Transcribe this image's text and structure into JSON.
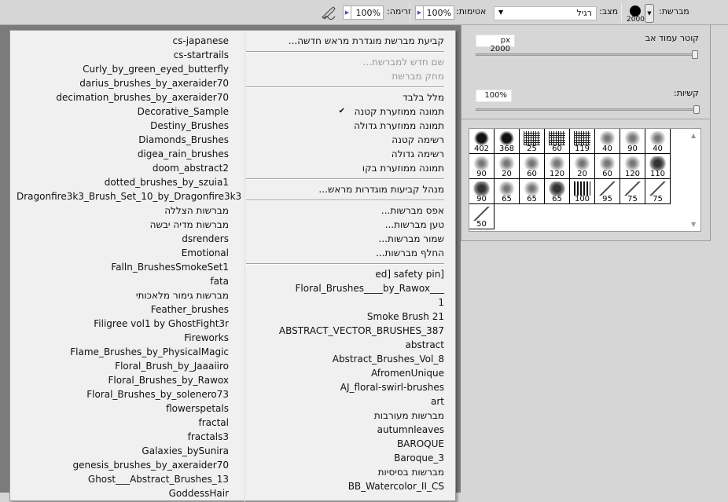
{
  "toolbar": {
    "brush_label": "מברשת:",
    "brush_size": "2000",
    "mode_label": "מצב:",
    "mode_value": "רגיל",
    "opacity_label": "אטימות:",
    "opacity_value": "100%",
    "flow_label": "זרימה:",
    "flow_value": "100%",
    "airbrush_icon": "airbrush-icon"
  },
  "panel": {
    "diameter_label": "קוטר עמוד אב",
    "diameter_value": "px 2000",
    "diameter_slider": 1.0,
    "hardness_label": "קשיות:",
    "hardness_value": "100%",
    "hardness_slider": 1.0,
    "brushes": [
      "402",
      "368",
      "25",
      "60",
      "119",
      "40",
      "90",
      "40",
      "90",
      "20",
      "60",
      "120",
      "20",
      "60",
      "120",
      "110",
      "90",
      "65",
      "65",
      "65",
      "100",
      "95",
      "75",
      "75",
      "50"
    ]
  },
  "menu": {
    "left_items": [
      "cs-japanese",
      "cs-startrails",
      "Curly_by_green_eyed_butterfly",
      "darius_brushes_by_axeraider70",
      "decimation_brushes_by_axeraider70",
      "Decorative_Sample",
      "Destiny_Brushes",
      "Diamonds_Brushes",
      "digea_rain_brushes",
      "doom_abstract2",
      "dotted_brushes_by_szuia1",
      "Dragonfire3k3_Brush_Set_10_by_Dragonfire3k3",
      "מברשות הצללה",
      "מברשות מדיה יבשה",
      "dsrenders",
      "Emotional",
      "Falln_BrushesSmokeSet1",
      "fata",
      "מברשות גימור מלאכותי",
      "Feather_brushes",
      "Filigree vol1 by GhostFight3r",
      "Fireworks",
      "Flame_Brushes_by_PhysicalMagic",
      "Floral_Brush_by_Jaaaiiro",
      "Floral_Brushes_by_Rawox",
      "Floral_Brushes_by_solenero73",
      "flowerspetals",
      "fractal",
      "fractals3",
      "Galaxies_bySunira",
      "genesis_brushes_by_axeraider70",
      "Ghost___Abstract_Brushes_13",
      "GoddessHair"
    ],
    "right_items": [
      {
        "label": "קביעת מברשת מוגדרת מראש חדשה..."
      },
      {
        "sep": true
      },
      {
        "label": "שם חדש למברשת...",
        "disabled": true
      },
      {
        "label": "מחק מברשת",
        "disabled": true
      },
      {
        "sep": true
      },
      {
        "label": "מלל בלבד"
      },
      {
        "label": "תמונה ממוזערת קטנה",
        "checked": true
      },
      {
        "label": "תמונה ממוזערת גדולה"
      },
      {
        "label": "רשימה קטנה"
      },
      {
        "label": "רשימה גדולה"
      },
      {
        "label": "תמונה ממוזערת בקו"
      },
      {
        "sep": true
      },
      {
        "label": "מנהל קביעות מוגדרות מראש..."
      },
      {
        "sep": true
      },
      {
        "label": "אפס מברשות..."
      },
      {
        "label": "טען מברשות..."
      },
      {
        "label": "שמור מברשות..."
      },
      {
        "label": "החלף מברשות..."
      },
      {
        "sep": true
      },
      {
        "label": "ed] safety pin]"
      },
      {
        "label": "Floral_Brushes____by_Rawox___"
      },
      {
        "label": "1"
      },
      {
        "label": "Smoke Brush 21"
      },
      {
        "label": "ABSTRACT_VECTOR_BRUSHES_387"
      },
      {
        "label": "abstract"
      },
      {
        "label": "Abstract_Brushes_Vol_8"
      },
      {
        "label": "AfromenUnique"
      },
      {
        "label": "AJ_floral-swirl-brushes"
      },
      {
        "label": "art"
      },
      {
        "label": "מברשות מעורבות"
      },
      {
        "label": "autumnleaves"
      },
      {
        "label": "BAROQUE"
      },
      {
        "label": "Baroque_3"
      },
      {
        "label": "מברשות בסיסיות"
      },
      {
        "label": "BB_Watercolor_II_CS"
      }
    ],
    "check_mark": "✔"
  }
}
